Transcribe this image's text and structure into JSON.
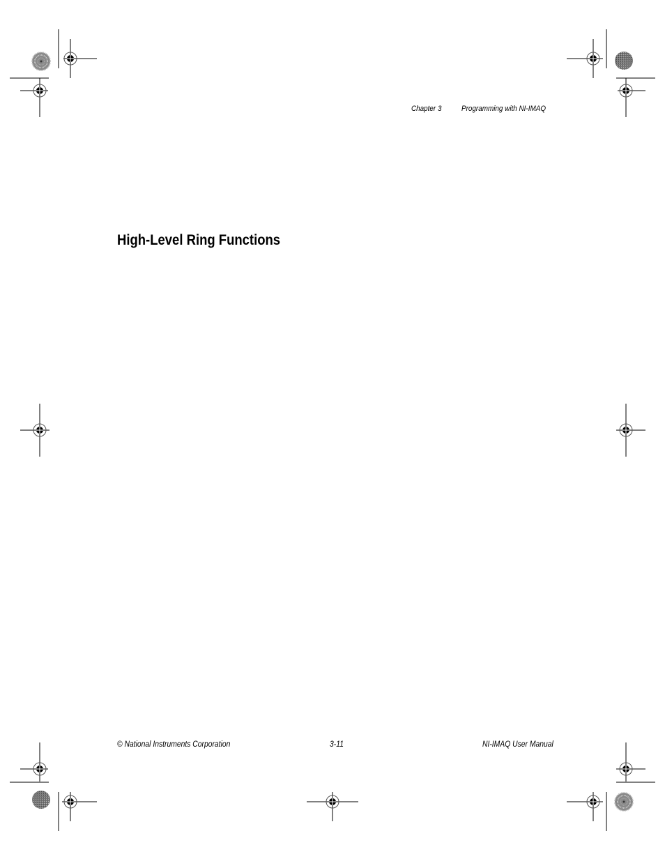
{
  "header": {
    "chapter": "Chapter 3",
    "chapter_title": "Programming with NI-IMAQ"
  },
  "section": {
    "heading": "High-Level Ring Functions"
  },
  "footer": {
    "copyright": "© National Instruments Corporation",
    "page_number": "3-11",
    "manual_title": "NI-IMAQ User Manual"
  }
}
